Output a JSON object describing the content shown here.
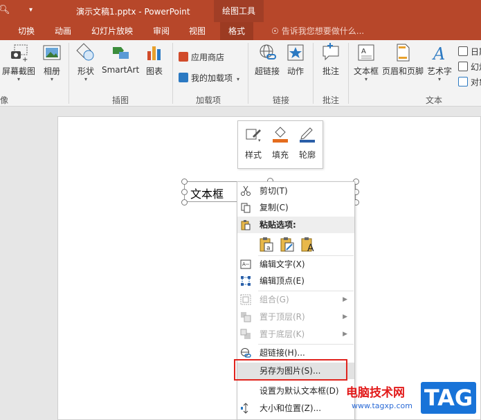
{
  "titlebar": {
    "title": "演示文稿1.pptx - PowerPoint",
    "context_tools": "绘图工具"
  },
  "tabs": [
    "切换",
    "动画",
    "幻灯片放映",
    "审阅",
    "视图",
    "格式"
  ],
  "active_tab": "格式",
  "tell_me": "告诉我您想要做什么...",
  "ribbon": {
    "screenshot": "屏幕截图",
    "album": "相册",
    "image_group": "像",
    "shapes": "形状",
    "smartart": "SmartArt",
    "chart": "图表",
    "illustrations_group": "插图",
    "app_store": "应用商店",
    "my_addins": "我的加载项",
    "addins_group": "加载项",
    "hyperlink": "超链接",
    "action": "动作",
    "links_group": "链接",
    "comment": "批注",
    "comments_group": "批注",
    "textbox": "文本框",
    "header_footer": "页眉和页脚",
    "wordart": "艺术字",
    "text_group": "文本",
    "date": "日期",
    "slide_number": "幻灯",
    "object": "对象"
  },
  "slide": {
    "textbox_text": "文本框"
  },
  "mini_toolbar": {
    "style": "样式",
    "fill": "填充",
    "outline": "轮廓"
  },
  "context_menu": {
    "cut": "剪切(T)",
    "copy": "复制(C)",
    "paste_options": "粘贴选项:",
    "edit_text": "编辑文字(X)",
    "edit_points": "编辑顶点(E)",
    "group": "组合(G)",
    "bring_front": "置于顶层(R)",
    "send_back": "置于底层(K)",
    "hyperlink": "超链接(H)...",
    "save_as_picture": "另存为图片(S)...",
    "set_default_textbox": "设置为默认文本框(D)",
    "size_position": "大小和位置(Z)..."
  },
  "watermark": {
    "site_name": "电脑技术网",
    "url": "www.tagxp.com",
    "tag": "TAG"
  },
  "colors": {
    "accent": "#b7472a",
    "highlight_box": "#e0231d"
  }
}
